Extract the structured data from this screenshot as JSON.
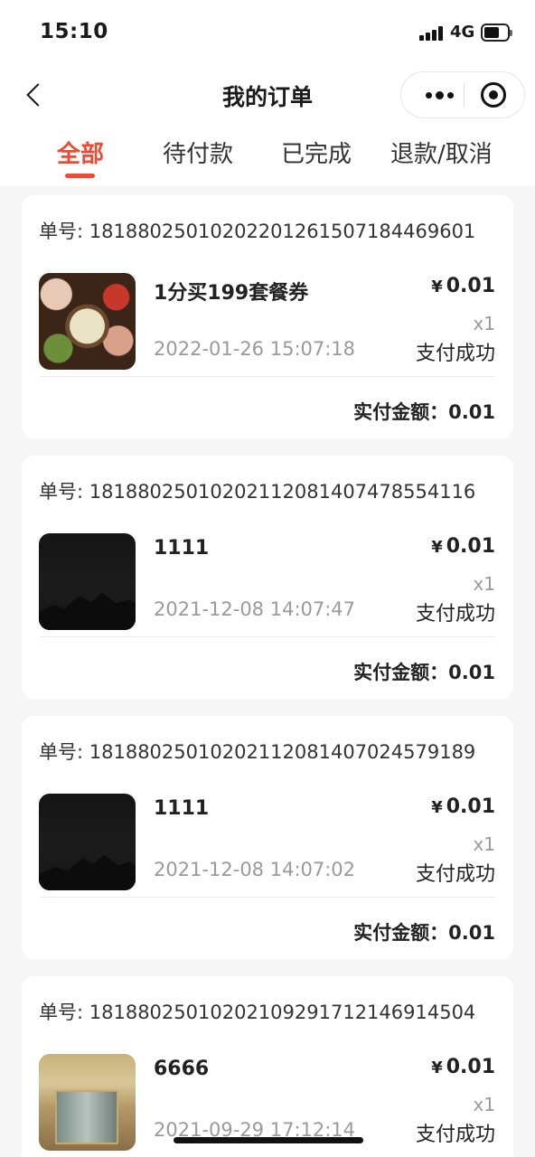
{
  "status_bar": {
    "time": "15:10",
    "network": "4G"
  },
  "nav": {
    "title": "我的订单"
  },
  "tabs": [
    {
      "label": "全部",
      "active": true
    },
    {
      "label": "待付款",
      "active": false
    },
    {
      "label": "已完成",
      "active": false
    },
    {
      "label": "退款/取消",
      "active": false
    }
  ],
  "orders": [
    {
      "order_no": "单号: 1818802501020220126150718446960​1",
      "name": "1分买199套餐券",
      "time": "2022-01-26 15:07:18",
      "currency": "¥",
      "price": "0.01",
      "qty": "x1",
      "status": "支付成功",
      "paid": "实付金额：0.01",
      "thumb": "food-icon"
    },
    {
      "order_no": "单号: 181880250102021120814074785541​16",
      "name": "1111",
      "time": "2021-12-08 14:07:47",
      "currency": "¥",
      "price": "0.01",
      "qty": "x1",
      "status": "支付成功",
      "paid": "实付金额：0.01",
      "thumb": "night-mountain-icon"
    },
    {
      "order_no": "单号: 181880250102021120814070245791​89",
      "name": "1111",
      "time": "2021-12-08 14:07:02",
      "currency": "¥",
      "price": "0.01",
      "qty": "x1",
      "status": "支付成功",
      "paid": "实付金额：0.01",
      "thumb": "night-mountain-icon"
    },
    {
      "order_no": "单号: 181880250102021092917121469145​04",
      "name": "6666",
      "time": "2021-09-29 17:12:14",
      "currency": "¥",
      "price": "0.01",
      "qty": "x1",
      "status": "支付成功",
      "paid": "",
      "thumb": "mall-store-icon"
    }
  ],
  "colors": {
    "accent": "#ef4a34",
    "background": "#f6f6f6"
  }
}
